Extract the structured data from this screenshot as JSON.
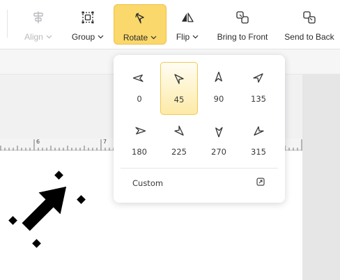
{
  "toolbar": {
    "align": {
      "label": "Align",
      "icon": "align-icon",
      "disabled": true
    },
    "group": {
      "label": "Group",
      "icon": "group-icon"
    },
    "rotate": {
      "label": "Rotate",
      "icon": "rotate-icon",
      "active": true
    },
    "flip": {
      "label": "Flip",
      "icon": "flip-icon"
    },
    "bring_to_front": {
      "label": "Bring to Front",
      "icon": "bring-to-front-icon"
    },
    "send_to_back": {
      "label": "Send to Back",
      "icon": "send-to-back-icon"
    }
  },
  "ruler": {
    "labels": [
      "6",
      "7"
    ]
  },
  "rotate_menu": {
    "options": [
      {
        "label": "0"
      },
      {
        "label": "45",
        "selected": true
      },
      {
        "label": "90"
      },
      {
        "label": "135"
      },
      {
        "label": "180"
      },
      {
        "label": "225"
      },
      {
        "label": "270"
      },
      {
        "label": "315"
      }
    ],
    "custom_label": "Custom",
    "custom_icon": "external-edit-icon"
  },
  "colors": {
    "accent": "#fad86b",
    "accent_border": "#eec24a"
  }
}
